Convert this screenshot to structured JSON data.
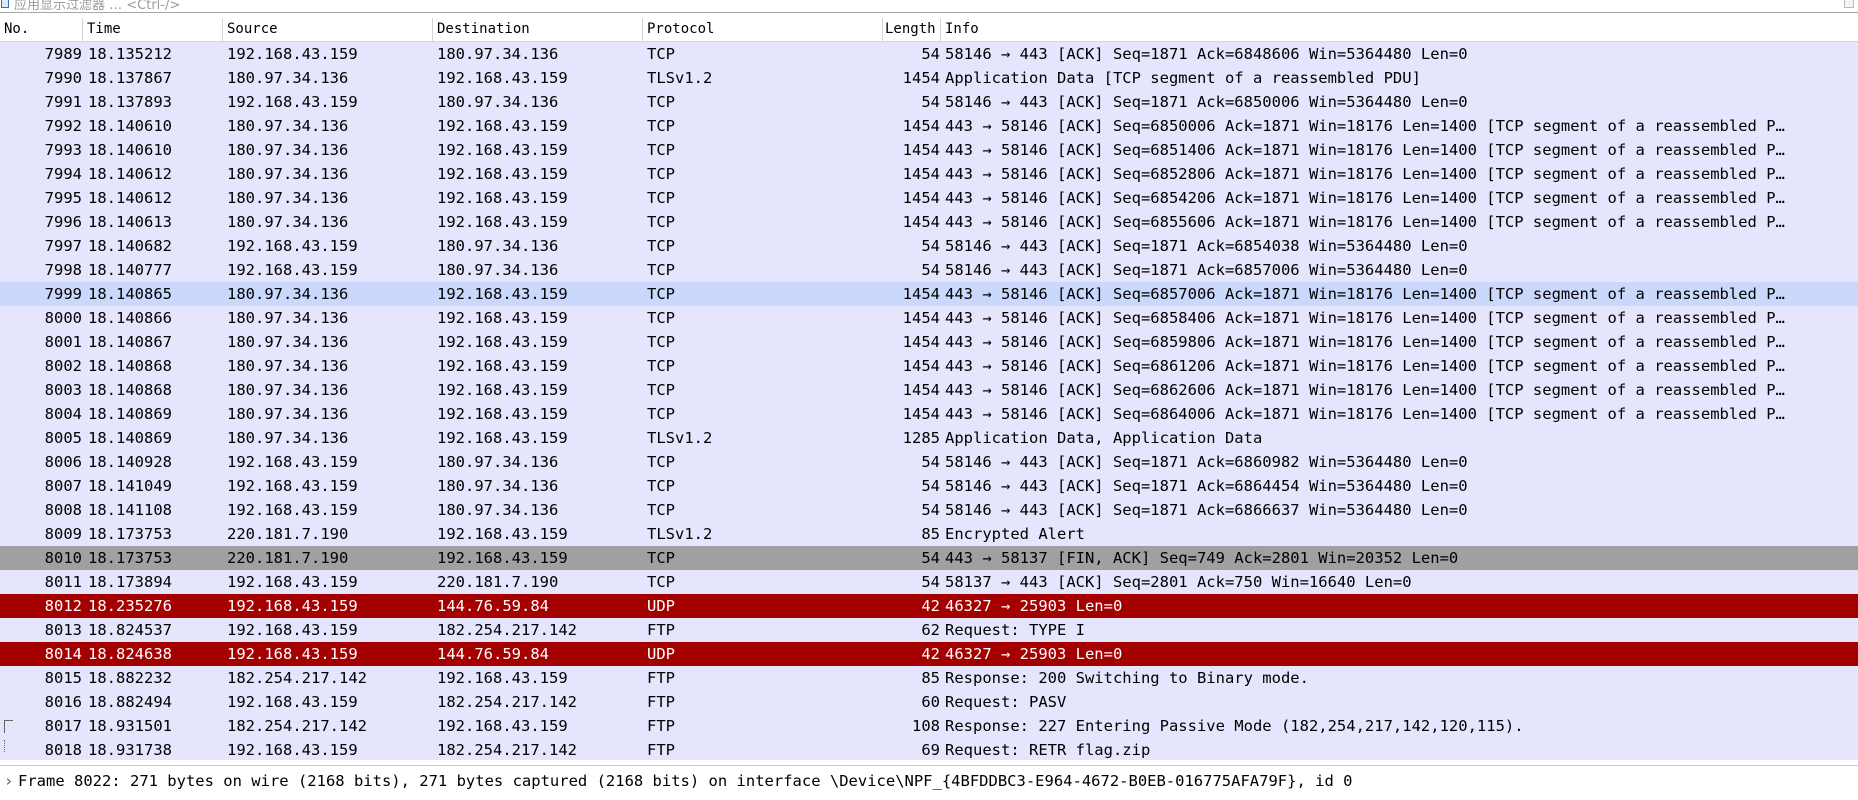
{
  "filter": {
    "placeholder": "应用显示过滤器 … <Ctrl-/>"
  },
  "columns": {
    "no": "No.",
    "time": "Time",
    "source": "Source",
    "destination": "Destination",
    "protocol": "Protocol",
    "length": "Length",
    "info": "Info"
  },
  "colors": {
    "default_bg": "#e5e5fe",
    "selected_bg": "#cad8fc",
    "fin_bg": "#a0a0a0",
    "udp_bg": "#a40000",
    "udp_fg": "#ffffff"
  },
  "rows": [
    {
      "no": "7989",
      "time": "18.135212",
      "src": "192.168.43.159",
      "dst": "180.97.34.136",
      "proto": "TCP",
      "len": "54",
      "info": "58146 → 443 [ACK] Seq=1871 Ack=6848606 Win=5364480 Len=0",
      "style": "default"
    },
    {
      "no": "7990",
      "time": "18.137867",
      "src": "180.97.34.136",
      "dst": "192.168.43.159",
      "proto": "TLSv1.2",
      "len": "1454",
      "info": "Application Data [TCP segment of a reassembled PDU]",
      "style": "default"
    },
    {
      "no": "7991",
      "time": "18.137893",
      "src": "192.168.43.159",
      "dst": "180.97.34.136",
      "proto": "TCP",
      "len": "54",
      "info": "58146 → 443 [ACK] Seq=1871 Ack=6850006 Win=5364480 Len=0",
      "style": "default"
    },
    {
      "no": "7992",
      "time": "18.140610",
      "src": "180.97.34.136",
      "dst": "192.168.43.159",
      "proto": "TCP",
      "len": "1454",
      "info": "443 → 58146 [ACK] Seq=6850006 Ack=1871 Win=18176 Len=1400 [TCP segment of a reassembled P…",
      "style": "default"
    },
    {
      "no": "7993",
      "time": "18.140610",
      "src": "180.97.34.136",
      "dst": "192.168.43.159",
      "proto": "TCP",
      "len": "1454",
      "info": "443 → 58146 [ACK] Seq=6851406 Ack=1871 Win=18176 Len=1400 [TCP segment of a reassembled P…",
      "style": "default"
    },
    {
      "no": "7994",
      "time": "18.140612",
      "src": "180.97.34.136",
      "dst": "192.168.43.159",
      "proto": "TCP",
      "len": "1454",
      "info": "443 → 58146 [ACK] Seq=6852806 Ack=1871 Win=18176 Len=1400 [TCP segment of a reassembled P…",
      "style": "default"
    },
    {
      "no": "7995",
      "time": "18.140612",
      "src": "180.97.34.136",
      "dst": "192.168.43.159",
      "proto": "TCP",
      "len": "1454",
      "info": "443 → 58146 [ACK] Seq=6854206 Ack=1871 Win=18176 Len=1400 [TCP segment of a reassembled P…",
      "style": "default"
    },
    {
      "no": "7996",
      "time": "18.140613",
      "src": "180.97.34.136",
      "dst": "192.168.43.159",
      "proto": "TCP",
      "len": "1454",
      "info": "443 → 58146 [ACK] Seq=6855606 Ack=1871 Win=18176 Len=1400 [TCP segment of a reassembled P…",
      "style": "default"
    },
    {
      "no": "7997",
      "time": "18.140682",
      "src": "192.168.43.159",
      "dst": "180.97.34.136",
      "proto": "TCP",
      "len": "54",
      "info": "58146 → 443 [ACK] Seq=1871 Ack=6854038 Win=5364480 Len=0",
      "style": "default"
    },
    {
      "no": "7998",
      "time": "18.140777",
      "src": "192.168.43.159",
      "dst": "180.97.34.136",
      "proto": "TCP",
      "len": "54",
      "info": "58146 → 443 [ACK] Seq=1871 Ack=6857006 Win=5364480 Len=0",
      "style": "default"
    },
    {
      "no": "7999",
      "time": "18.140865",
      "src": "180.97.34.136",
      "dst": "192.168.43.159",
      "proto": "TCP",
      "len": "1454",
      "info": "443 → 58146 [ACK] Seq=6857006 Ack=1871 Win=18176 Len=1400 [TCP segment of a reassembled P…",
      "style": "selected"
    },
    {
      "no": "8000",
      "time": "18.140866",
      "src": "180.97.34.136",
      "dst": "192.168.43.159",
      "proto": "TCP",
      "len": "1454",
      "info": "443 → 58146 [ACK] Seq=6858406 Ack=1871 Win=18176 Len=1400 [TCP segment of a reassembled P…",
      "style": "default"
    },
    {
      "no": "8001",
      "time": "18.140867",
      "src": "180.97.34.136",
      "dst": "192.168.43.159",
      "proto": "TCP",
      "len": "1454",
      "info": "443 → 58146 [ACK] Seq=6859806 Ack=1871 Win=18176 Len=1400 [TCP segment of a reassembled P…",
      "style": "default"
    },
    {
      "no": "8002",
      "time": "18.140868",
      "src": "180.97.34.136",
      "dst": "192.168.43.159",
      "proto": "TCP",
      "len": "1454",
      "info": "443 → 58146 [ACK] Seq=6861206 Ack=1871 Win=18176 Len=1400 [TCP segment of a reassembled P…",
      "style": "default"
    },
    {
      "no": "8003",
      "time": "18.140868",
      "src": "180.97.34.136",
      "dst": "192.168.43.159",
      "proto": "TCP",
      "len": "1454",
      "info": "443 → 58146 [ACK] Seq=6862606 Ack=1871 Win=18176 Len=1400 [TCP segment of a reassembled P…",
      "style": "default"
    },
    {
      "no": "8004",
      "time": "18.140869",
      "src": "180.97.34.136",
      "dst": "192.168.43.159",
      "proto": "TCP",
      "len": "1454",
      "info": "443 → 58146 [ACK] Seq=6864006 Ack=1871 Win=18176 Len=1400 [TCP segment of a reassembled P…",
      "style": "default"
    },
    {
      "no": "8005",
      "time": "18.140869",
      "src": "180.97.34.136",
      "dst": "192.168.43.159",
      "proto": "TLSv1.2",
      "len": "1285",
      "info": "Application Data, Application Data",
      "style": "default"
    },
    {
      "no": "8006",
      "time": "18.140928",
      "src": "192.168.43.159",
      "dst": "180.97.34.136",
      "proto": "TCP",
      "len": "54",
      "info": "58146 → 443 [ACK] Seq=1871 Ack=6860982 Win=5364480 Len=0",
      "style": "default"
    },
    {
      "no": "8007",
      "time": "18.141049",
      "src": "192.168.43.159",
      "dst": "180.97.34.136",
      "proto": "TCP",
      "len": "54",
      "info": "58146 → 443 [ACK] Seq=1871 Ack=6864454 Win=5364480 Len=0",
      "style": "default"
    },
    {
      "no": "8008",
      "time": "18.141108",
      "src": "192.168.43.159",
      "dst": "180.97.34.136",
      "proto": "TCP",
      "len": "54",
      "info": "58146 → 443 [ACK] Seq=1871 Ack=6866637 Win=5364480 Len=0",
      "style": "default"
    },
    {
      "no": "8009",
      "time": "18.173753",
      "src": "220.181.7.190",
      "dst": "192.168.43.159",
      "proto": "TLSv1.2",
      "len": "85",
      "info": "Encrypted Alert",
      "style": "default"
    },
    {
      "no": "8010",
      "time": "18.173753",
      "src": "220.181.7.190",
      "dst": "192.168.43.159",
      "proto": "TCP",
      "len": "54",
      "info": "443 → 58137 [FIN, ACK] Seq=749 Ack=2801 Win=20352 Len=0",
      "style": "fin"
    },
    {
      "no": "8011",
      "time": "18.173894",
      "src": "192.168.43.159",
      "dst": "220.181.7.190",
      "proto": "TCP",
      "len": "54",
      "info": "58137 → 443 [ACK] Seq=2801 Ack=750 Win=16640 Len=0",
      "style": "default"
    },
    {
      "no": "8012",
      "time": "18.235276",
      "src": "192.168.43.159",
      "dst": "144.76.59.84",
      "proto": "UDP",
      "len": "42",
      "info": "46327 → 25903 Len=0",
      "style": "udp"
    },
    {
      "no": "8013",
      "time": "18.824537",
      "src": "192.168.43.159",
      "dst": "182.254.217.142",
      "proto": "FTP",
      "len": "62",
      "info": "Request: TYPE I",
      "style": "default"
    },
    {
      "no": "8014",
      "time": "18.824638",
      "src": "192.168.43.159",
      "dst": "144.76.59.84",
      "proto": "UDP",
      "len": "42",
      "info": "46327 → 25903 Len=0",
      "style": "udp"
    },
    {
      "no": "8015",
      "time": "18.882232",
      "src": "182.254.217.142",
      "dst": "192.168.43.159",
      "proto": "FTP",
      "len": "85",
      "info": "Response: 200 Switching to Binary mode.",
      "style": "default"
    },
    {
      "no": "8016",
      "time": "18.882494",
      "src": "192.168.43.159",
      "dst": "182.254.217.142",
      "proto": "FTP",
      "len": "60",
      "info": "Request: PASV",
      "style": "default"
    },
    {
      "no": "8017",
      "time": "18.931501",
      "src": "182.254.217.142",
      "dst": "192.168.43.159",
      "proto": "FTP",
      "len": "108",
      "info": "Response: 227 Entering Passive Mode (182,254,217,142,120,115).",
      "style": "default"
    },
    {
      "no": "8018",
      "time": "18.931738",
      "src": "192.168.43.159",
      "dst": "182.254.217.142",
      "proto": "FTP",
      "len": "69",
      "info": "Request: RETR flag.zip",
      "style": "default"
    }
  ],
  "detail": {
    "frame_line": "Frame 8022: 271 bytes on wire (2168 bits), 271 bytes captured (2168 bits) on interface \\Device\\NPF_{4BFDDBC3-E964-4672-B0EB-016775AFA79F}, id 0"
  }
}
